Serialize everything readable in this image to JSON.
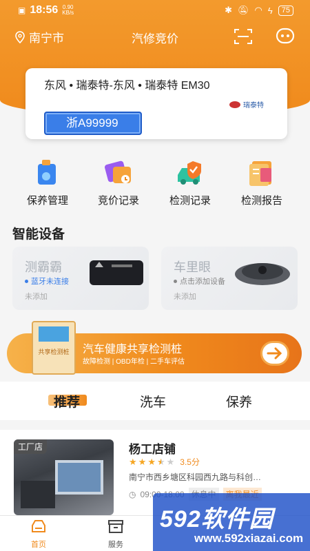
{
  "status_bar": {
    "time": "18:56",
    "speed_value": "0.90",
    "speed_unit": "KB/s",
    "battery": "75"
  },
  "top_bar": {
    "location": "南宁市",
    "title": "汽修竞价"
  },
  "vehicle": {
    "name": "东风 • 瑞泰特-东风 • 瑞泰特 EM30",
    "plate": "浙A99999",
    "brand": "瑞泰特"
  },
  "quick_actions": [
    {
      "label": "保养管理",
      "icon": "maintenance-icon"
    },
    {
      "label": "竞价记录",
      "icon": "bid-record-icon"
    },
    {
      "label": "检测记录",
      "icon": "inspection-record-icon"
    },
    {
      "label": "检测报告",
      "icon": "inspection-report-icon"
    }
  ],
  "smart_devices": {
    "title": "智能设备",
    "items": [
      {
        "name": "测霸霸",
        "status": "蓝牙未连接",
        "sub": "未添加",
        "status_color": "#3a7ee8"
      },
      {
        "name": "车里眼",
        "status": "点击添加设备",
        "sub": "未添加",
        "status_color": "#888888"
      }
    ]
  },
  "banner": {
    "title": "汽车健康共享检测桩",
    "subtitle": "故障检测 | OBD年检 | 二手车评估",
    "kiosk_text": "共享检测桩"
  },
  "tabs": [
    {
      "label": "推荐"
    },
    {
      "label": "洗车"
    },
    {
      "label": "保养"
    }
  ],
  "shop": {
    "tag": "工厂店",
    "name": "杨工店铺",
    "rating": 3.5,
    "score": "3.5分",
    "address": "南宁市西乡塘区科园西九路与科创…",
    "hours": "09:00-18:00",
    "status": "休息中",
    "nearest": "离我最近"
  },
  "bottom_nav": [
    {
      "label": "首页"
    },
    {
      "label": "服务"
    }
  ],
  "watermark": {
    "main": "592软件园",
    "sub": "www.592xiazai.com"
  },
  "colors": {
    "primary": "#f08a1c",
    "plate_blue": "#3a7ee8"
  }
}
